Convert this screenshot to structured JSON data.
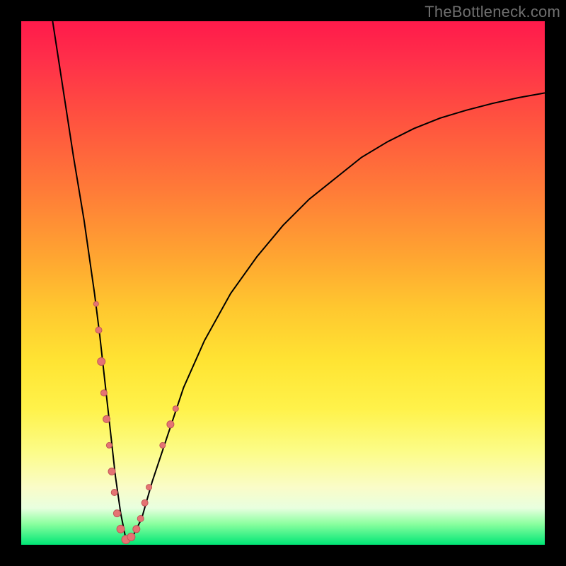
{
  "watermark": "TheBottleneck.com",
  "colors": {
    "frame": "#000000",
    "curve": "#000000",
    "marker_fill": "#e57373",
    "marker_stroke": "#c05658",
    "gradient_top": "#ff1a4b",
    "gradient_bottom": "#00e676"
  },
  "chart_data": {
    "type": "line",
    "title": "",
    "xlabel": "",
    "ylabel": "",
    "xlim": [
      0,
      100
    ],
    "ylim": [
      0,
      100
    ],
    "grid": false,
    "curve": {
      "x": [
        6,
        8,
        10,
        12,
        14,
        15,
        16,
        17,
        18,
        19,
        20,
        21,
        23,
        25,
        28,
        31,
        35,
        40,
        45,
        50,
        55,
        60,
        65,
        70,
        75,
        80,
        85,
        90,
        95,
        100
      ],
      "y": [
        100,
        87,
        74,
        62,
        48,
        40,
        31,
        22,
        13,
        6,
        1,
        1,
        5,
        12,
        21,
        30,
        39,
        48,
        55,
        61,
        66,
        70,
        74,
        77,
        79.5,
        81.5,
        83,
        84.3,
        85.4,
        86.3
      ]
    },
    "markers": [
      {
        "x": 14.3,
        "y": 46,
        "r": 3.5
      },
      {
        "x": 14.8,
        "y": 41,
        "r": 4.5
      },
      {
        "x": 15.3,
        "y": 35,
        "r": 5.5
      },
      {
        "x": 15.8,
        "y": 29,
        "r": 4.5
      },
      {
        "x": 16.3,
        "y": 24,
        "r": 5.0
      },
      {
        "x": 16.8,
        "y": 19,
        "r": 4.0
      },
      {
        "x": 17.3,
        "y": 14,
        "r": 5.0
      },
      {
        "x": 17.8,
        "y": 10,
        "r": 4.5
      },
      {
        "x": 18.3,
        "y": 6,
        "r": 5.0
      },
      {
        "x": 19.0,
        "y": 3,
        "r": 5.5
      },
      {
        "x": 20.0,
        "y": 1,
        "r": 6.0
      },
      {
        "x": 21.0,
        "y": 1.5,
        "r": 5.5
      },
      {
        "x": 22.0,
        "y": 3,
        "r": 5.0
      },
      {
        "x": 22.8,
        "y": 5,
        "r": 4.5
      },
      {
        "x": 23.6,
        "y": 8,
        "r": 4.5
      },
      {
        "x": 24.4,
        "y": 11,
        "r": 4.0
      },
      {
        "x": 27.0,
        "y": 19,
        "r": 4.0
      },
      {
        "x": 28.5,
        "y": 23,
        "r": 5.0
      },
      {
        "x": 29.5,
        "y": 26,
        "r": 4.0
      }
    ]
  }
}
